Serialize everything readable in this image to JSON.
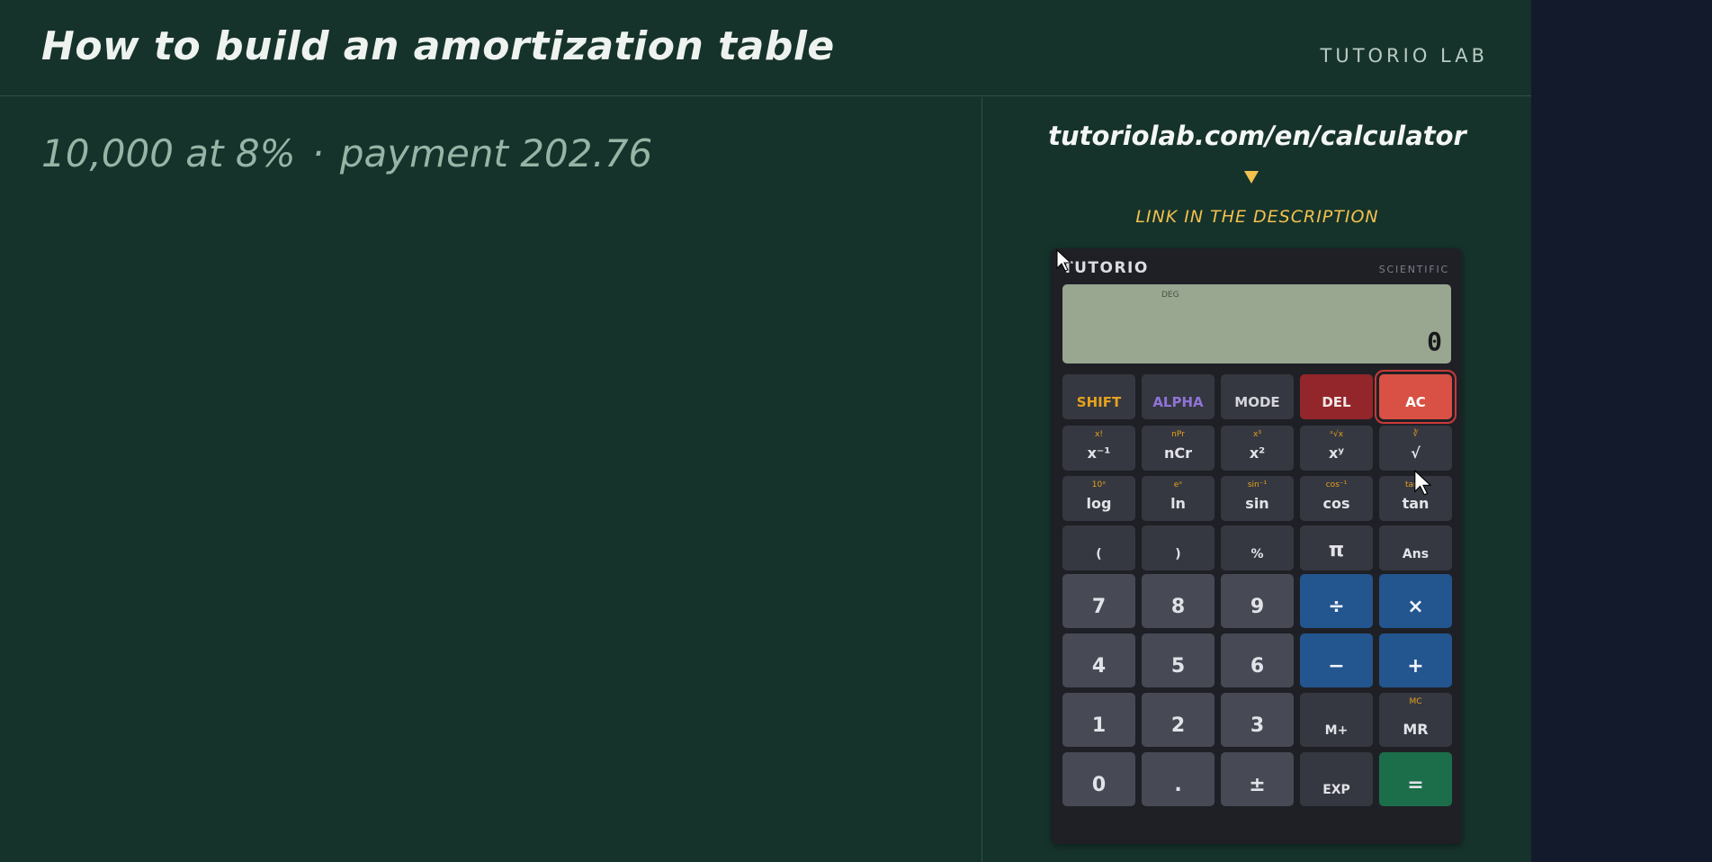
{
  "header": {
    "title": "How to build an amortization table",
    "brand": "TUTORIO LAB"
  },
  "lesson": {
    "amount_rate": "10,000 at 8%",
    "separator": "·",
    "payment": "payment 202.76"
  },
  "promo": {
    "url": "tutoriolab.com/en/calculator",
    "link_text": "LINK IN THE DESCRIPTION",
    "accent_color": "#f2c14e"
  },
  "calculator": {
    "brand": "TUTORIO",
    "mode": "SCIENTIFIC",
    "display": {
      "angle_mode": "DEG",
      "value": "0"
    },
    "keys": [
      {
        "id": "shift",
        "label": "SHIFT",
        "alt": ""
      },
      {
        "id": "alpha",
        "label": "ALPHA",
        "alt": ""
      },
      {
        "id": "mode",
        "label": "MODE",
        "alt": ""
      },
      {
        "id": "del",
        "label": "DEL",
        "alt": ""
      },
      {
        "id": "ac",
        "label": "AC",
        "alt": ""
      },
      {
        "id": "inverse",
        "label": "x⁻¹",
        "alt": "x!"
      },
      {
        "id": "ncr",
        "label": "nCr",
        "alt": "nPr"
      },
      {
        "id": "square",
        "label": "x²",
        "alt": "x³"
      },
      {
        "id": "power",
        "label": "xʸ",
        "alt": "ˣ√x"
      },
      {
        "id": "sqrt",
        "label": "√",
        "alt": "∛"
      },
      {
        "id": "log",
        "label": "log",
        "alt": "10ˣ"
      },
      {
        "id": "ln",
        "label": "ln",
        "alt": "eˣ"
      },
      {
        "id": "sin",
        "label": "sin",
        "alt": "sin⁻¹"
      },
      {
        "id": "cos",
        "label": "cos",
        "alt": "cos⁻¹"
      },
      {
        "id": "tan",
        "label": "tan",
        "alt": "tan⁻¹"
      },
      {
        "id": "lparen",
        "label": "(",
        "alt": ""
      },
      {
        "id": "rparen",
        "label": ")",
        "alt": ""
      },
      {
        "id": "percent",
        "label": "%",
        "alt": ""
      },
      {
        "id": "pi",
        "label": "π",
        "alt": ""
      },
      {
        "id": "ans",
        "label": "Ans",
        "alt": ""
      },
      {
        "id": "7",
        "label": "7",
        "alt": ""
      },
      {
        "id": "8",
        "label": "8",
        "alt": ""
      },
      {
        "id": "9",
        "label": "9",
        "alt": ""
      },
      {
        "id": "divide",
        "label": "÷",
        "alt": ""
      },
      {
        "id": "multiply",
        "label": "×",
        "alt": ""
      },
      {
        "id": "4",
        "label": "4",
        "alt": ""
      },
      {
        "id": "5",
        "label": "5",
        "alt": ""
      },
      {
        "id": "6",
        "label": "6",
        "alt": ""
      },
      {
        "id": "minus",
        "label": "−",
        "alt": ""
      },
      {
        "id": "plus",
        "label": "+",
        "alt": ""
      },
      {
        "id": "1",
        "label": "1",
        "alt": ""
      },
      {
        "id": "2",
        "label": "2",
        "alt": ""
      },
      {
        "id": "3",
        "label": "3",
        "alt": ""
      },
      {
        "id": "mplus",
        "label": "M+",
        "alt": ""
      },
      {
        "id": "mr",
        "label": "MR",
        "alt": "MC"
      },
      {
        "id": "0",
        "label": "0",
        "alt": ""
      },
      {
        "id": "dot",
        "label": ".",
        "alt": ""
      },
      {
        "id": "negate",
        "label": "±",
        "alt": ""
      },
      {
        "id": "exp",
        "label": "EXP",
        "alt": ""
      },
      {
        "id": "equals",
        "label": "=",
        "alt": ""
      }
    ]
  }
}
